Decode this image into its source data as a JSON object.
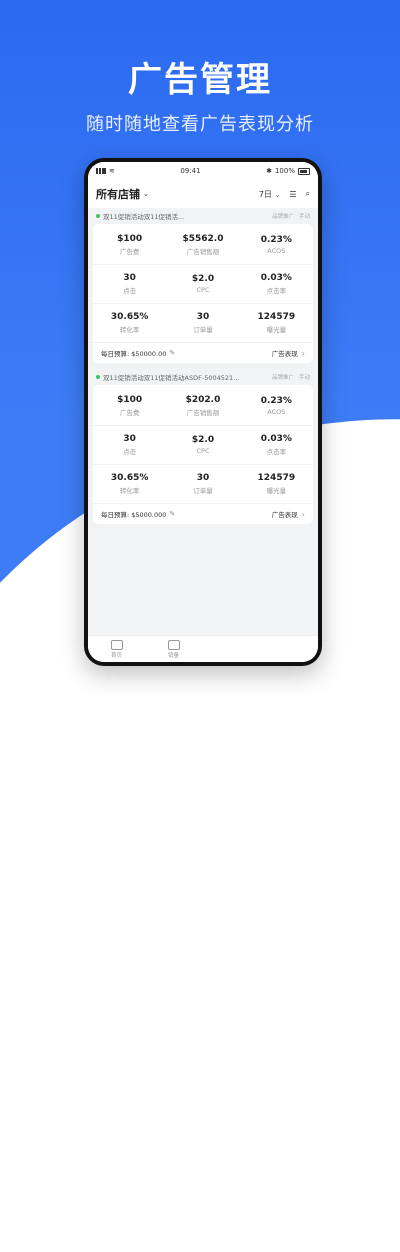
{
  "promo": {
    "title": "广告管理",
    "subtitle": "随时随地查看广告表现分析"
  },
  "status": {
    "time": "09:41",
    "battery": "100%"
  },
  "header": {
    "store": "所有店铺",
    "range": "7日",
    "icons": [
      "chevron-down-icon",
      "sort-icon",
      "search-icon"
    ]
  },
  "campaigns": [
    {
      "name": "双11促销活动双11促销活...",
      "tag1": "品牌推广",
      "tag2": "手动",
      "metrics": [
        {
          "value": "$100",
          "label": "广告费"
        },
        {
          "value": "$5562.0",
          "label": "广告销售额"
        },
        {
          "value": "0.23%",
          "label": "ACOS"
        },
        {
          "value": "30",
          "label": "点击"
        },
        {
          "value": "$2.0",
          "label": "CPC"
        },
        {
          "value": "0.03%",
          "label": "点击率"
        },
        {
          "value": "30.65%",
          "label": "转化率"
        },
        {
          "value": "30",
          "label": "订单量"
        },
        {
          "value": "124579",
          "label": "曝光量"
        }
      ],
      "budget": "每日预算: $50000.00",
      "report": "广告表现"
    },
    {
      "name": "双11促销活动双11促销活动ASDF-5004521...",
      "tag1": "品牌推广",
      "tag2": "手动",
      "metrics": [
        {
          "value": "$100",
          "label": "广告费"
        },
        {
          "value": "$202.0",
          "label": "广告销售额"
        },
        {
          "value": "0.23%",
          "label": "ACOS"
        },
        {
          "value": "30",
          "label": "点击"
        },
        {
          "value": "$2.0",
          "label": "CPC"
        },
        {
          "value": "0.03%",
          "label": "点击率"
        },
        {
          "value": "30.65%",
          "label": "转化率"
        },
        {
          "value": "30",
          "label": "订单量"
        },
        {
          "value": "124579",
          "label": "曝光量"
        }
      ],
      "budget": "每日预算: $5000.000",
      "report": "广告表现"
    }
  ],
  "tabs": [
    {
      "label": "首页",
      "icon": "home-icon"
    },
    {
      "label": "销量",
      "icon": "sales-icon"
    }
  ],
  "colors": {
    "brand_blue": "#2b6af0",
    "active_dot": "#3ac569"
  }
}
